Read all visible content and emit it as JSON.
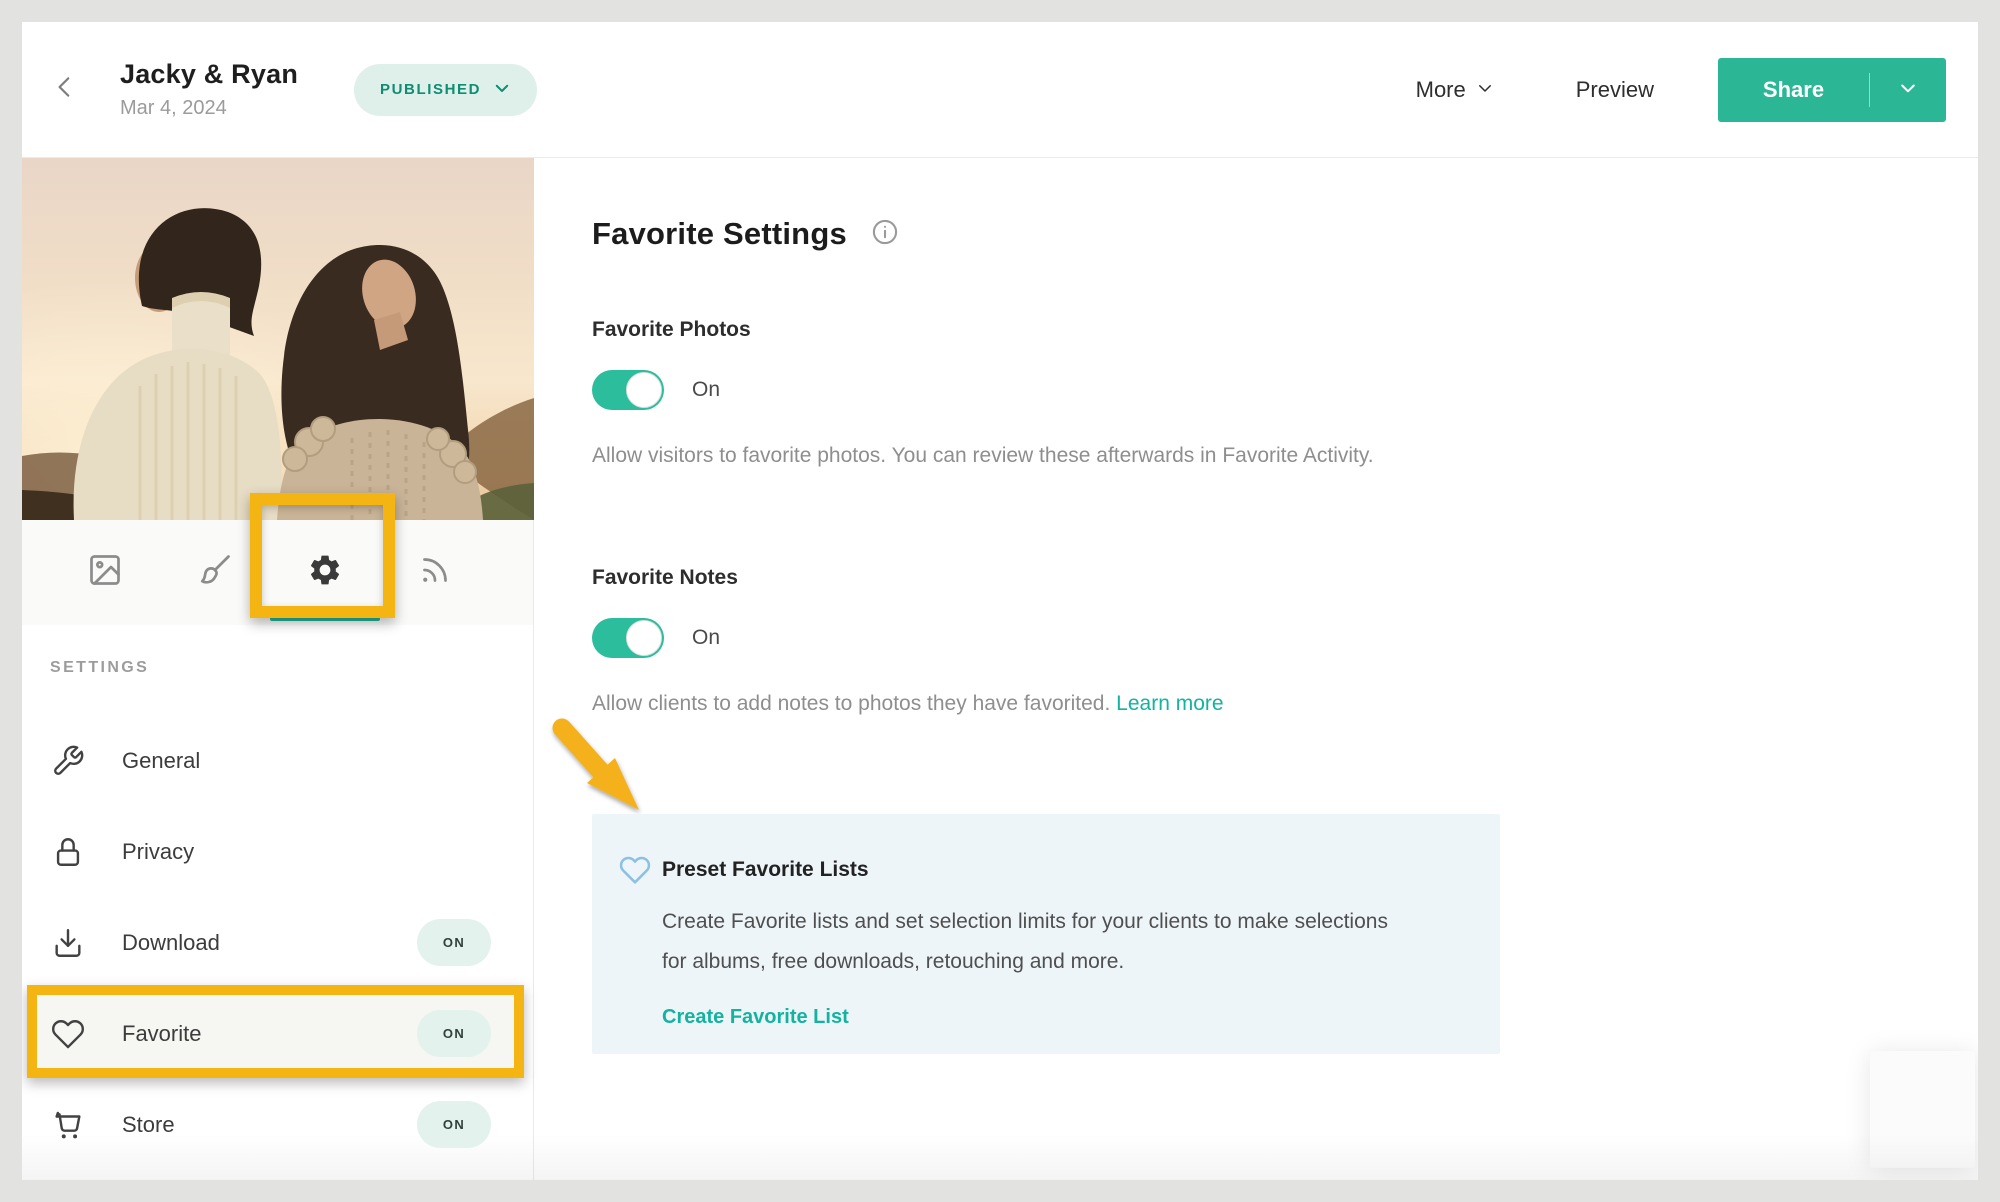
{
  "header": {
    "title": "Jacky & Ryan",
    "date": "Mar 4, 2024",
    "status_label": "PUBLISHED",
    "more_label": "More",
    "preview_label": "Preview",
    "share_label": "Share"
  },
  "sidebar": {
    "section_label": "SETTINGS",
    "tabs": [
      {
        "icon": "image-icon",
        "active": false
      },
      {
        "icon": "brush-icon",
        "active": false
      },
      {
        "icon": "gear-icon",
        "active": true
      },
      {
        "icon": "signal-icon",
        "active": false
      }
    ],
    "items": [
      {
        "label": "General",
        "icon": "wrench-icon"
      },
      {
        "label": "Privacy",
        "icon": "lock-icon"
      },
      {
        "label": "Download",
        "icon": "download-icon",
        "badge": "ON"
      },
      {
        "label": "Favorite",
        "icon": "heart-icon",
        "badge": "ON",
        "highlighted": true
      },
      {
        "label": "Store",
        "icon": "cart-icon",
        "badge": "ON"
      }
    ]
  },
  "main": {
    "title": "Favorite Settings",
    "sections": [
      {
        "heading": "Favorite Photos",
        "toggle_state": "On",
        "description": "Allow visitors to favorite photos. You can review these afterwards in Favorite Activity."
      },
      {
        "heading": "Favorite Notes",
        "toggle_state": "On",
        "description": "Allow clients to add notes to photos they have favorited.",
        "link": "Learn more"
      }
    ],
    "panel": {
      "title": "Preset Favorite Lists",
      "description": "Create Favorite lists and set selection limits for your clients to make selections for albums, free downloads, retouching and more.",
      "link": "Create Favorite List"
    }
  },
  "colors": {
    "accent_teal": "#2bb795",
    "toggle_teal": "#2cbd9d",
    "link_teal": "#14b3a0",
    "status_pill_bg": "#def0e9",
    "status_pill_text": "#0f8d74",
    "badge_bg": "#e3f2ec",
    "panel_bg": "#eef5f9",
    "panel_heart_blue": "#8cc0e4",
    "highlight_yellow": "#f4b513",
    "frame_gray": "#e2e2e1"
  }
}
